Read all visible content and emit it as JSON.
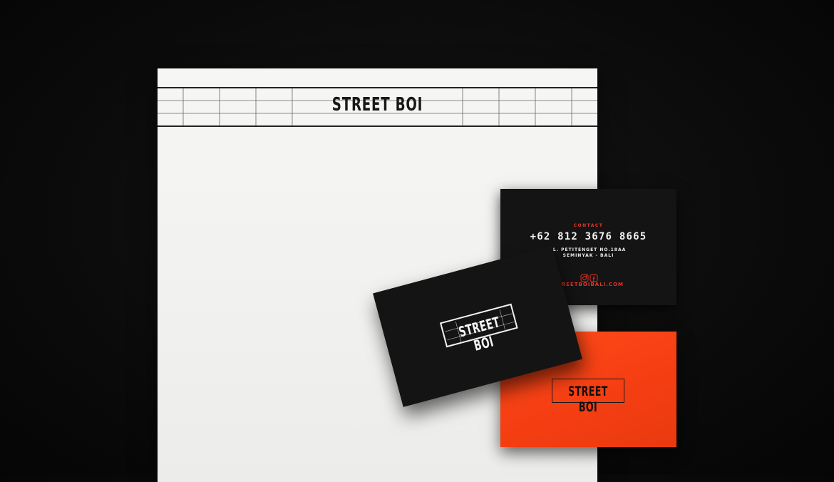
{
  "brand": {
    "name": "STREET BOI"
  },
  "letterhead": {
    "logo_text": "STREET BOI"
  },
  "business_card_back": {
    "contact_label": "CONTACT",
    "phone": "+62 812 3676 8665",
    "address_line1": "JL. PETITENGET NO.18AA",
    "address_line2": "SEMINYAK - BALI",
    "social_icons": [
      "instagram-icon",
      "facebook-icon"
    ],
    "website": "STREETBOIBALI.COM"
  },
  "business_card_front": {
    "logo_text": "STREET BOI"
  },
  "business_card_orange": {
    "logo_text": "STREET BOI"
  },
  "colors": {
    "background": "#0b0b0b",
    "paper": "#f3f3f1",
    "card_black": "#141414",
    "accent_red": "#e3332a",
    "card_orange": "#f43e12"
  }
}
